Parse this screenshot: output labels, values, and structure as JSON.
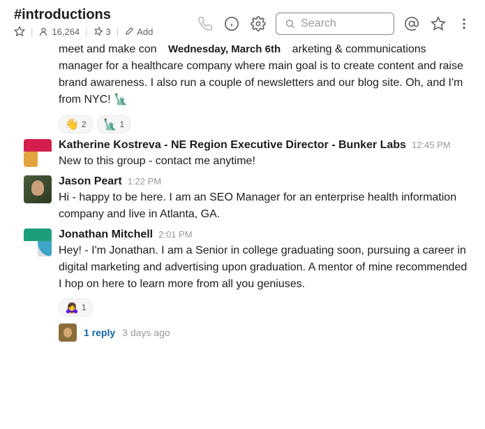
{
  "header": {
    "channel_name": "#introductions",
    "members": "16,264",
    "pins": "3",
    "add_label": "Add",
    "search_placeholder": "Search"
  },
  "date_divider": "Wednesday, March 6th",
  "cut_message": {
    "pre": "meet and make con",
    "post": "arketing & communications manager for a healthcare company where main goal is to create content and raise brand awareness. I also run a couple of newsletters and our blog site. Oh, and I'm from NYC! 🗽"
  },
  "reactions_cut": [
    {
      "emoji": "👋",
      "count": "2"
    },
    {
      "emoji": "🗽",
      "count": "1"
    }
  ],
  "messages": [
    {
      "author": "Katherine Kostreva - NE Region Executive Director - Bunker Labs",
      "time": "12:45 PM",
      "text": "New to this group - contact me anytime!",
      "avatar": "kl"
    },
    {
      "author": "Jason Peart",
      "time": "1:22 PM",
      "text": "Hi - happy to be here. I am an SEO Manager for an enterprise health information company and live in Atlanta, GA.",
      "avatar": "jp"
    },
    {
      "author": "Jonathan Mitchell",
      "time": "2:01 PM",
      "text": "Hey! - I'm Jonathan.  I am a Senior in college graduating soon, pursuing a career in digital marketing and advertising upon graduation.  A mentor of mine recommended I hop on here to learn more from all you geniuses.",
      "avatar": "jm",
      "reactions": [
        {
          "emoji": "🙇‍♀️",
          "count": "1"
        }
      ],
      "thread": {
        "reply_text": "1 reply",
        "reply_time": "3 days ago"
      }
    }
  ]
}
